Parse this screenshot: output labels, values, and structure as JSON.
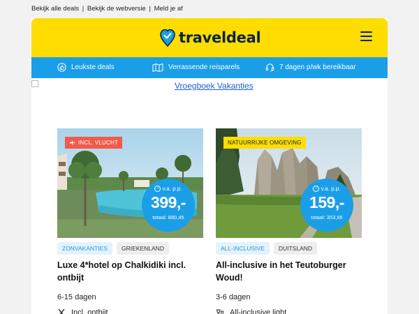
{
  "topbar": {
    "link_all_deals": "Bekijk alle deals",
    "link_webversion": "Bekijk de webversie",
    "link_unsubscribe": "Meld je af",
    "separator": "|"
  },
  "header": {
    "logo_text": "traveldeal",
    "logo_icon": "heart-pin-icon",
    "menu_icon": "hamburger-menu-icon",
    "brand_color": "#ffdd00",
    "accent_color": "#1a9ee8"
  },
  "usp_bar": {
    "items": [
      {
        "icon": "thumbs-up-icon",
        "label": "Leukste deals"
      },
      {
        "icon": "map-icon",
        "label": "Verrassende reisparels"
      },
      {
        "icon": "headset-icon",
        "label": "7 dagen p/wk bereikbaar"
      }
    ]
  },
  "banner": {
    "alt_text": "Vroegboek Vakanties"
  },
  "deals": [
    {
      "badge": "INCL. VLUCHT",
      "badge_icon": "plane-icon",
      "badge_color": "#f25a4a",
      "price_prefix": "v.a. p.p.",
      "price": "399,-",
      "total": "totaal: 880,45",
      "tags": [
        "ZONVAKANTIES",
        "GRIEKENLAND"
      ],
      "title": "Luxe 4*hotel op Chalkidiki incl. ontbijt",
      "duration": "6-15 dagen",
      "extra": "Incl. ontbijt",
      "extra_icon": "cutlery-icon"
    },
    {
      "badge": "NATUURRIJKE OMGEVING",
      "badge_color": "#ffdd00",
      "price_prefix": "v.a. p.p.",
      "price": "159,-",
      "total": "totaal: 353,95",
      "tags": [
        "ALL-INCLUSIVE",
        "DUITSLAND"
      ],
      "title": "All-inclusive in het Teutoburger Woud!",
      "duration": "3-6 dagen",
      "extra": "All-inclusive light",
      "extra_icon": "drinks-icon"
    }
  ]
}
